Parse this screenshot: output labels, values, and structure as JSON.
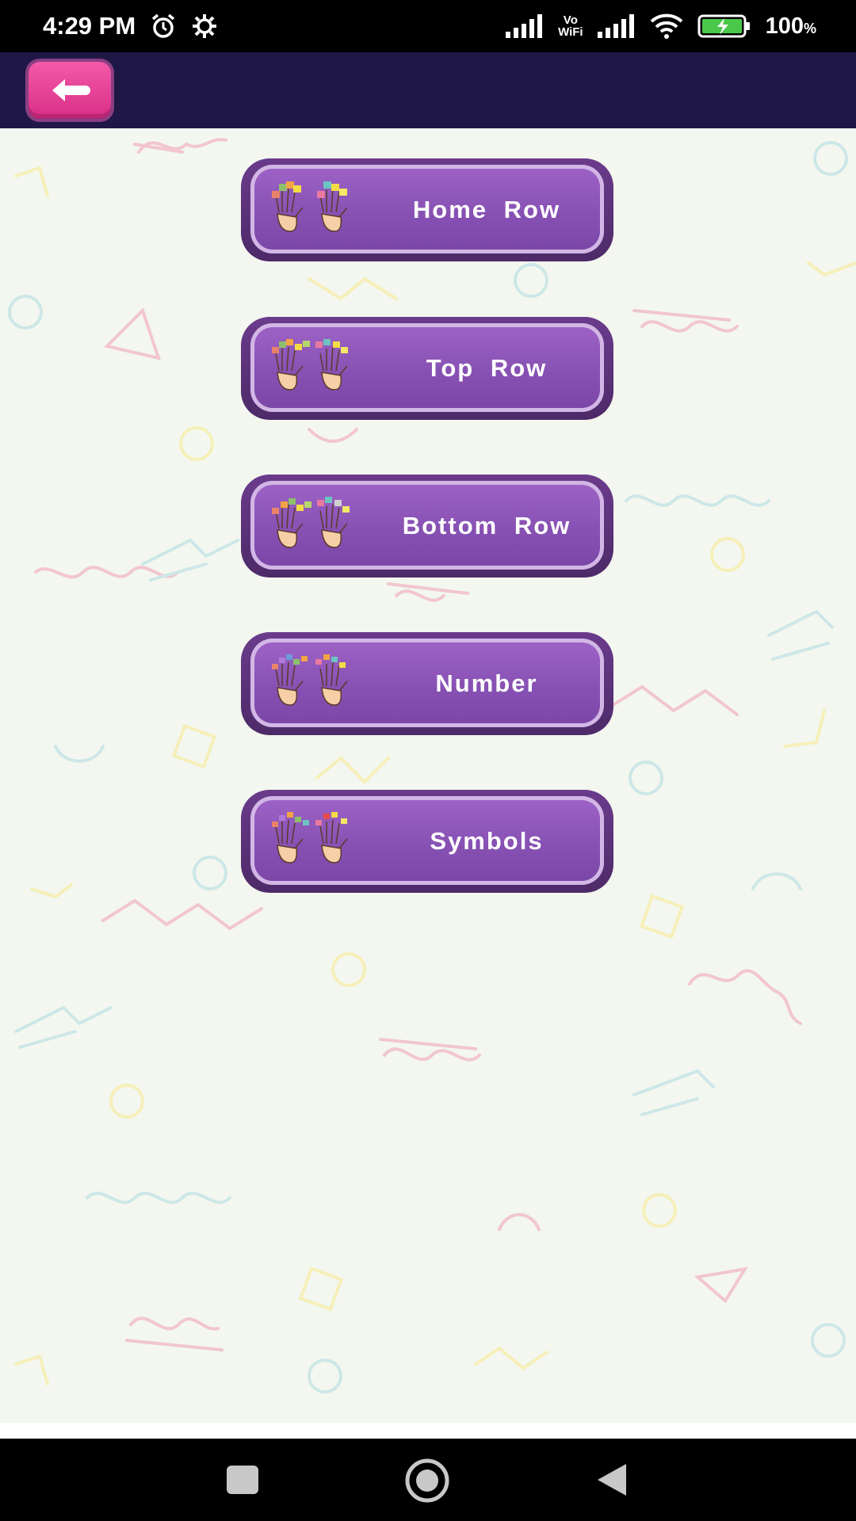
{
  "status_bar": {
    "time": "4:29 PM",
    "vo": "Vo",
    "wifi_label": "WiFi",
    "battery": "100",
    "battery_unit": "%",
    "icons": [
      "alarm-icon",
      "settings-gear-icon",
      "signal-icon",
      "vowifi-icon",
      "signal-icon",
      "wifi-icon",
      "battery-charging-icon"
    ]
  },
  "app_bar": {
    "back_icon": "arrow-left-icon",
    "back_color": "#e83d96",
    "background": "#1f1846"
  },
  "menu": {
    "items": [
      {
        "label": "Home  Row",
        "icon": "hands-keys-icon"
      },
      {
        "label": "Top  Row",
        "icon": "hands-keys-icon"
      },
      {
        "label": "Bottom  Row",
        "icon": "hands-keys-icon"
      },
      {
        "label": "Number",
        "icon": "hands-keys-icon"
      },
      {
        "label": "Symbols",
        "icon": "hands-keys-icon"
      }
    ],
    "button_color": "#8751b3"
  },
  "nav_bar": {
    "icons": [
      "recents-square-icon",
      "home-circle-icon",
      "back-triangle-icon"
    ]
  }
}
